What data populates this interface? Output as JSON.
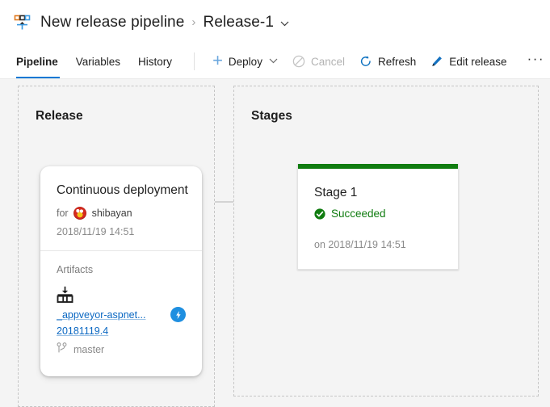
{
  "header": {
    "icon": "release-pipeline-icon",
    "pipeline_name": "New release pipeline",
    "separator": "›",
    "release_name": "Release-1",
    "release_chevron": "⌄"
  },
  "toolbar": {
    "tabs": [
      {
        "label": "Pipeline",
        "active": true
      },
      {
        "label": "Variables",
        "active": false
      },
      {
        "label": "History",
        "active": false
      }
    ],
    "actions": [
      {
        "label": "Deploy",
        "icon": "plus-icon",
        "disabled": false,
        "has_caret": true
      },
      {
        "label": "Cancel",
        "icon": "cancel-icon",
        "disabled": true,
        "has_caret": false
      },
      {
        "label": "Refresh",
        "icon": "refresh-icon",
        "disabled": false,
        "has_caret": false
      },
      {
        "label": "Edit release",
        "icon": "pencil-icon",
        "disabled": false,
        "has_caret": false
      }
    ],
    "more_label": "···",
    "accent_color": "#0078d4"
  },
  "canvas": {
    "release_panel": {
      "title": "Release"
    },
    "stages_panel": {
      "title": "Stages"
    },
    "release_card": {
      "title": "Continuous deployment",
      "for_label": "for",
      "avatar": "user-avatar",
      "user": "shibayan",
      "created_date": "2018/11/19 14:51",
      "artifacts_label": "Artifacts",
      "artifact_icon": "artifact-package-icon",
      "artifact_name": "_appveyor-aspnet...",
      "artifact_version": "20181119.4",
      "branch_icon": "branch-icon",
      "branch_name": "master",
      "trigger_badge_icon": "lightning-bolt-icon",
      "trigger_badge_color": "#1f8fe0"
    },
    "stage_card": {
      "name": "Stage 1",
      "status": "Succeeded",
      "status_icon": "success-check-icon",
      "status_color": "#107c10",
      "bar_color": "#107c10",
      "date": "on 2018/11/19 14:51"
    }
  }
}
